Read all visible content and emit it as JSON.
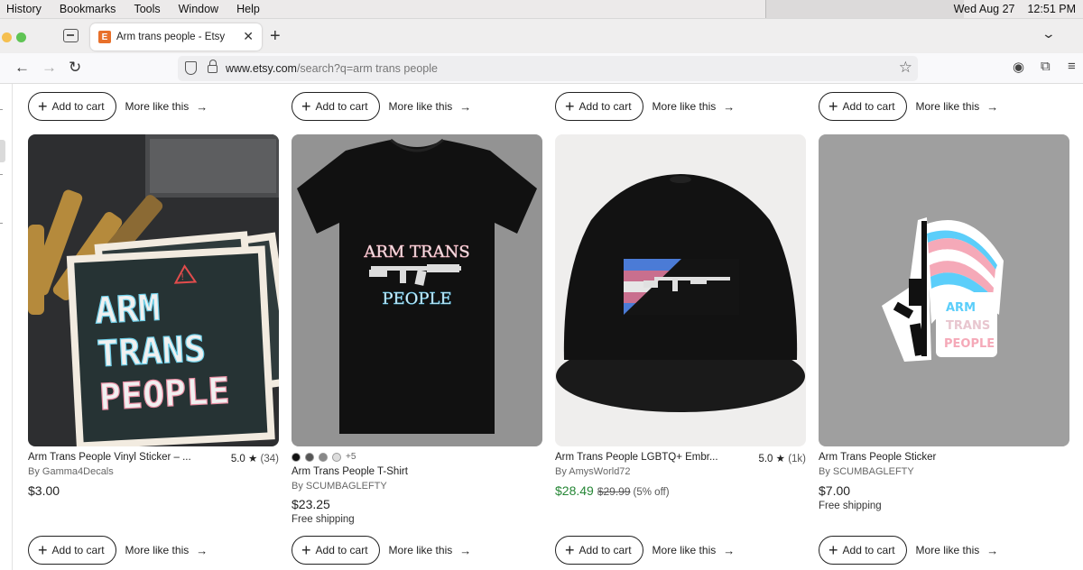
{
  "menubar": {
    "items": [
      "History",
      "Bookmarks",
      "Tools",
      "Window",
      "Help"
    ],
    "date": "Wed Aug 27",
    "time": "12:51 PM"
  },
  "tab": {
    "favicon_letter": "E",
    "title": "Arm trans people - Etsy",
    "close": "✕",
    "new_tab": "+"
  },
  "address": {
    "host": "www.etsy.com",
    "path": "/search?q=arm trans people"
  },
  "actions": {
    "add_to_cart": "Add to cart",
    "more_like_this": "More like this"
  },
  "products": [
    {
      "title": "Arm Trans People Vinyl Sticker – ...",
      "rating": "5.0",
      "reviews": "(34)",
      "seller": "By Gamma4Decals",
      "price": "$3.00",
      "sticker_text": [
        "ARM",
        "TRANS",
        "PEOPLE"
      ]
    },
    {
      "swatch_more": "+5",
      "title": "Arm Trans People T-Shirt",
      "seller": "By SCUMBAGLEFTY",
      "price": "$23.25",
      "shipping": "Free shipping",
      "shirt_text": [
        "ARM TRANS",
        "PEOPLE"
      ]
    },
    {
      "title": "Arm Trans People LGBTQ+ Embr...",
      "rating": "5.0",
      "reviews": "(1k)",
      "seller": "By AmysWorld72",
      "price": "$28.49",
      "original_price": "$29.99",
      "discount": "(5% off)"
    },
    {
      "title": "Arm Trans People Sticker",
      "seller": "By SCUMBAGLEFTY",
      "price": "$7.00",
      "shipping": "Free shipping",
      "sticker_text": [
        "ARM",
        "TRANS",
        "PEOPLE"
      ]
    }
  ],
  "colors": {
    "etsy_orange": "#e8702a",
    "sale_green": "#258635",
    "trans_blue": "#5bcefa",
    "trans_pink": "#f5a9b8"
  }
}
